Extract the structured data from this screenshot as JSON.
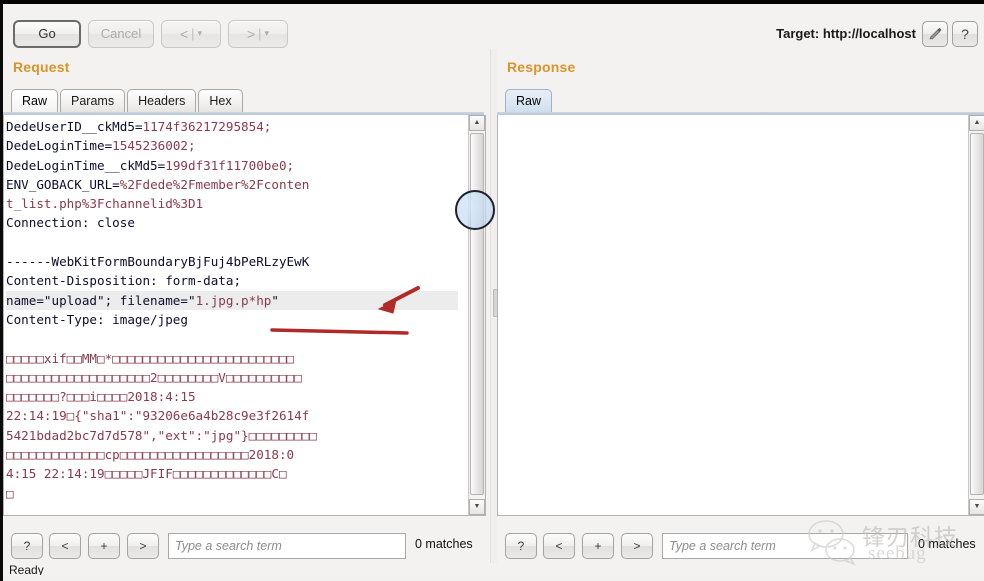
{
  "window": {
    "status_text": "Ready"
  },
  "toolbar": {
    "go_label": "Go",
    "cancel_label": "Cancel",
    "prev_label": "<",
    "next_label": ">",
    "caret_glyph": "▾",
    "separator": "|",
    "target_label": "Target: http://localhost",
    "edit_target_icon": "pencil-icon",
    "help_label": "?",
    "accent_color": "#d9942a"
  },
  "request": {
    "title": "Request",
    "tabs": [
      {
        "label": "Raw",
        "selected": true
      },
      {
        "label": "Params",
        "selected": false
      },
      {
        "label": "Headers",
        "selected": false
      },
      {
        "label": "Hex",
        "selected": false
      }
    ],
    "body_lines": [
      {
        "text": "DedeUserID__ckMd5=",
        "value": "1174f36217295854;",
        "kind": "kv"
      },
      {
        "text": "DedeLoginTime=",
        "value": "1545236002;",
        "kind": "kv"
      },
      {
        "text": "DedeLoginTime__ckMd5=",
        "value": "199df31f11700be0;",
        "kind": "kv"
      },
      {
        "text": "ENV_GOBACK_URL=",
        "value": "%2Fdede%2Fmember%2Fconten",
        "kind": "kv"
      },
      {
        "text": "",
        "value": "t_list.php%3Fchannelid%3D1",
        "kind": "cont"
      },
      {
        "text": "Connection: close",
        "value": "",
        "kind": "plain"
      },
      {
        "text": "",
        "value": "",
        "kind": "blank"
      },
      {
        "text": "------WebKitFormBoundaryBjFuj4bPeRLzyEwK",
        "value": "",
        "kind": "plain"
      },
      {
        "text": "Content-Disposition: form-data;",
        "value": "",
        "kind": "plain"
      },
      {
        "text": "name=\"upload\"; filename=\"",
        "value": "1.jpg.p*hp",
        "suffix": "\"",
        "kind": "highlight"
      },
      {
        "text": "Content-Type: image/jpeg",
        "value": "",
        "kind": "plain"
      },
      {
        "text": "",
        "value": "",
        "kind": "blank"
      },
      {
        "text": "",
        "value": "□□□□□xif□□MM□*□□□□□□□□□□□□□□□□□□□□□□□□",
        "kind": "bin"
      },
      {
        "text": "",
        "value": "□□□□□□□□□□□□□□□□□□□2□□□□□□□□V□□□□□□□□□□",
        "kind": "bin"
      },
      {
        "text": "",
        "value": "□□□□□□□?□□□i□□□□2018:4:15",
        "kind": "bin"
      },
      {
        "text": "",
        "value": "22:14:19□{\"sha1\":\"93206e6a4b28c9e3f2614f",
        "kind": "bin"
      },
      {
        "text": "",
        "value": "5421bdad2bc7d7d578\",\"ext\":\"jpg\"}□□□□□□□□□",
        "kind": "bin"
      },
      {
        "text": "",
        "value": "□□□□□□□□□□□□□cp□□□□□□□□□□□□□□□□□2018:0",
        "kind": "bin"
      },
      {
        "text": "",
        "value": "4:15 22:14:19□□□□□JFIF□□□□□□□□□□□□□C□",
        "kind": "bin"
      },
      {
        "text": "",
        "value": "□",
        "kind": "bin"
      }
    ],
    "search": {
      "help_label": "?",
      "prev_label": "<",
      "add_label": "+",
      "next_label": ">",
      "placeholder": "Type a search term",
      "value": "",
      "matches": "0 matches"
    }
  },
  "response": {
    "title": "Response",
    "tabs": [
      {
        "label": "Raw",
        "selected": true
      }
    ],
    "body": "",
    "search": {
      "help_label": "?",
      "prev_label": "<",
      "add_label": "+",
      "next_label": ">",
      "placeholder": "Type a search term",
      "value": "",
      "matches": "0 matches"
    }
  },
  "annotations": {
    "arrow_color": "#b02a2a",
    "underline_color": "#b02a2a",
    "target_text": "1.jpg.p*hp"
  },
  "watermark": {
    "title": "锋刃科技",
    "subtitle": "seebug"
  }
}
